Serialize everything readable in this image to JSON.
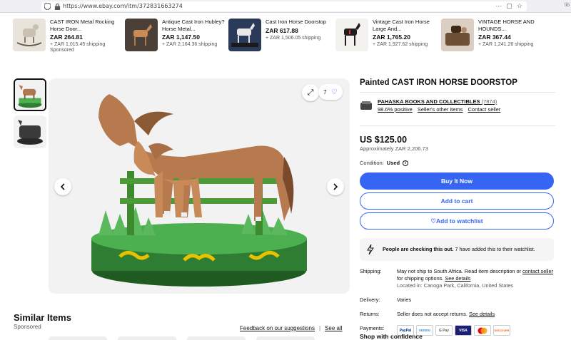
{
  "browser": {
    "url": "https://www.ebay.com/itm/372831663274",
    "edge_text": "lib"
  },
  "carousel": [
    {
      "title": "CAST IRON Metal Rocking Horse Door...",
      "price": "ZAR 264.81",
      "shipping": "+ ZAR 1,015.45 shipping",
      "sponsored": "Sponsored"
    },
    {
      "title": "Antique Cast Iron Hubley? Horse Metal...",
      "price": "ZAR 1,147.50",
      "shipping": "+ ZAR 2,164.36 shipping",
      "sponsored": ""
    },
    {
      "title": "Cast Iron Horse Doorstop",
      "price": "ZAR 617.88",
      "shipping": "+ ZAR 1,506.05 shipping",
      "sponsored": ""
    },
    {
      "title": "Vintage Cast Iron Horse Large And...",
      "price": "ZAR 1,765.20",
      "shipping": "+ ZAR 1,927.62 shipping",
      "sponsored": ""
    },
    {
      "title": "VINTAGE HORSE AND HOUNDS...",
      "price": "ZAR 367.44",
      "shipping": "+ ZAR 1,241.26 shipping",
      "sponsored": ""
    }
  ],
  "gallery": {
    "watch_count": "7"
  },
  "similar": {
    "title": "Similar Items",
    "subtitle": "Sponsored",
    "feedback_link": "Feedback on our suggestions",
    "separator": "|",
    "see_all": "See all"
  },
  "item": {
    "title": "Painted CAST IRON HORSE DOORSTOP",
    "seller_name": "PAHASKA BOOKS AND COLLECTIBLES",
    "seller_count": "(7874)",
    "seller_positive": "98.6% positive",
    "seller_other_items": "Seller's other items",
    "contact_seller": "Contact seller",
    "price": "US $125.00",
    "approx": "Approximately ZAR 2,206.73",
    "condition_label": "Condition:",
    "condition_value": "Used",
    "buy_now": "Buy It Now",
    "add_to_cart": "Add to cart",
    "add_to_watchlist": "Add to watchlist",
    "notice_bold": "People are checking this out.",
    "notice_rest": " 7 have added this to their watchlist.",
    "shipping_label": "Shipping:",
    "shipping_text": "May not ship to South Africa. Read item description or ",
    "contact_seller_link": "contact seller",
    "shipping_text2": " for shipping options. ",
    "see_details": "See details",
    "located": "Located in: Canoga Park, California, United States",
    "delivery_label": "Delivery:",
    "delivery_value": "Varies",
    "returns_label": "Returns:",
    "returns_text": "Seller does not accept returns. ",
    "returns_see_details": "See details",
    "payments_label": "Payments:",
    "payments": [
      "PayPal",
      "venmo",
      "G Pay",
      "VISA",
      "MC",
      "DISCOVER"
    ],
    "shop_confidence": "Shop with confidence"
  },
  "colors": {
    "ebay_blue": "#3665f3",
    "paypal": "#003087",
    "venmo": "#3d95ce",
    "visa": "#1a1f71",
    "mastercard": "#eb001b",
    "discover": "#ff6000"
  }
}
